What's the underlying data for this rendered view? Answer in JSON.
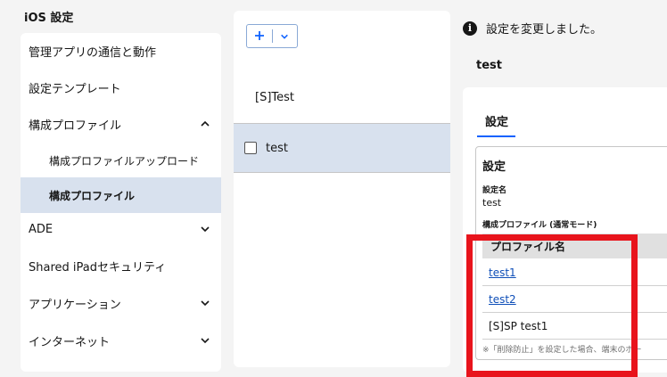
{
  "sidebar": {
    "title": "iOS 設定",
    "items": [
      {
        "label": "管理アプリの通信と動作",
        "chevron": ""
      },
      {
        "label": "設定テンプレート",
        "chevron": ""
      },
      {
        "label": "構成プロファイル",
        "chevron": "up"
      },
      {
        "label": "構成プロファイルアップロード",
        "chevron": "",
        "sub": true
      },
      {
        "label": "構成プロファイル",
        "chevron": "",
        "sub": true,
        "active": true
      },
      {
        "label": "ADE",
        "chevron": "down"
      },
      {
        "label": "Shared iPadセキュリティ",
        "chevron": ""
      },
      {
        "label": "アプリケーション",
        "chevron": "down"
      },
      {
        "label": "インターネット",
        "chevron": "down"
      }
    ]
  },
  "list": {
    "add_icon": "plus-icon",
    "dropdown_icon": "chevron-down-icon",
    "group_header": "[S]Test",
    "rows": [
      {
        "label": "test",
        "checked": false
      }
    ]
  },
  "detail": {
    "toast": "設定を変更しました。",
    "title": "test",
    "tab": "設定",
    "section_heading": "設定",
    "name_label": "設定名",
    "name_value": "test",
    "profile_label": "構成プロファイル (通常モード)",
    "profile_table": {
      "header": "プロファイル名",
      "rows": [
        {
          "name": "test1",
          "link": true
        },
        {
          "name": "test2",
          "link": true
        },
        {
          "name": "[S]SP test1",
          "link": false
        }
      ]
    },
    "note": "※「削除防止」を設定した場合、端末のポー"
  },
  "colors": {
    "accent": "#0f62fe",
    "active_bg": "#d8e1ee",
    "highlight": "#e8141c",
    "link": "#0f4fb8"
  }
}
